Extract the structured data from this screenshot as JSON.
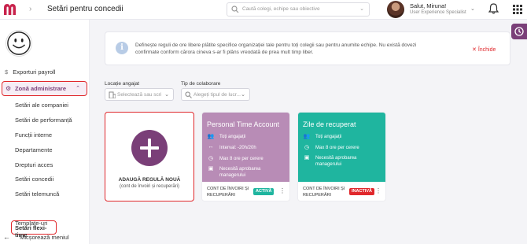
{
  "header": {
    "title": "Setări pentru concedii",
    "search_placeholder": "Caută colegi, echipe sau obiective",
    "user_name": "Salut, Miruna!",
    "user_role": "User Experience Specialist"
  },
  "sidebar": {
    "payroll": "Exporturi payroll",
    "admin": "Zonă administrare",
    "items": [
      "Setări ale companiei",
      "Setări de performanță",
      "Funcții interne",
      "Departamente",
      "Drepturi acces",
      "Setări concedii",
      "Setări telemuncă",
      "Setări flexi-time",
      "Template-uri"
    ],
    "collapse": "Micșorează meniul"
  },
  "info": {
    "text": "Definește reguli de ore libere plătite specifice organizației tale pentru toți colegii sau pentru anumite echipe. Nu există dovezi confirmate conform cărora cineva s-ar fi plâns vreodată de prea mult timp liber.",
    "close": "Închide"
  },
  "filters": {
    "location_label": "Locație angajat",
    "location_placeholder": "Selectează sau scrie...",
    "type_label": "Tip de colaborare",
    "type_placeholder": "Alegeți tipul de lucr..."
  },
  "add_card": {
    "title": "ADAUGĂ REGULĂ NOUĂ",
    "subtitle": "(cont de învoiri și recuperări)"
  },
  "rules": [
    {
      "title": "Personal Time Account",
      "color": "#b88cb6",
      "lines": [
        "Toți angajații",
        "Interval: -20h/20h",
        "Max 8 ore per cerere",
        "Necesită aprobarea managerului"
      ],
      "footer": "CONT DE ÎNVOIRI ȘI RECUPERĂRI",
      "status": "ACTIVĂ",
      "status_color": "#1fb59f"
    },
    {
      "title": "Zile de recuperat",
      "color": "#1fb59f",
      "lines": [
        "Toți angajații",
        "Max 8 ore per cerere",
        "Necesită aprobarea managerului"
      ],
      "footer": "CONT DE ÎNVOIRI ȘI RECUPERĂRI",
      "status": "INACTIVĂ",
      "status_color": "#e0282c"
    }
  ]
}
